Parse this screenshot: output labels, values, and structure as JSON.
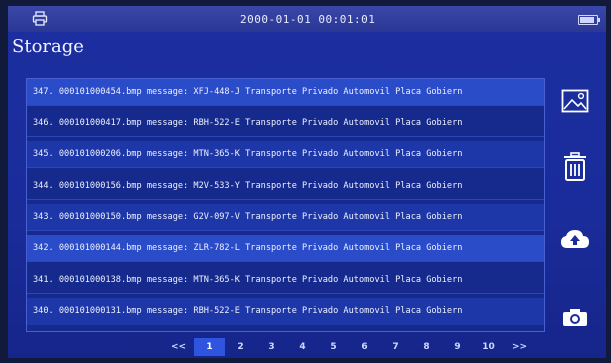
{
  "status": {
    "datetime": "2000-01-01 00:01:01"
  },
  "title": "Storage",
  "files": [
    "347. 000101000454.bmp message: XFJ-448-J Transporte Privado Automovil Placa Gobiern",
    "346. 000101000417.bmp message: RBH-522-E Transporte Privado Automovil Placa Gobiern",
    "345. 000101000206.bmp message: MTN-365-K Transporte Privado Automovil Placa Gobiern",
    "344. 000101000156.bmp message: M2V-533-Y Transporte Privado Automovil Placa Gobiern",
    "343. 000101000150.bmp message: G2V-097-V Transporte Privado Automovil Placa Gobiern",
    "342. 000101000144.bmp message: ZLR-782-L Transporte Privado Automovil Placa Gobiern",
    "341. 000101000138.bmp message: MTN-365-K Transporte Privado Automovil Placa Gobiern",
    "340. 000101000131.bmp message: RBH-522-E Transporte Privado Automovil Placa Gobiern"
  ],
  "pager": {
    "prev": "<<",
    "pages": [
      "1",
      "2",
      "3",
      "4",
      "5",
      "6",
      "7",
      "8",
      "9",
      "10"
    ],
    "next": ">>",
    "active": "1"
  },
  "icons": {
    "printer": "printer-icon",
    "battery": "battery-icon",
    "image": "image-icon",
    "delete": "trash-icon",
    "upload": "cloud-upload-icon",
    "camera": "camera-icon"
  }
}
